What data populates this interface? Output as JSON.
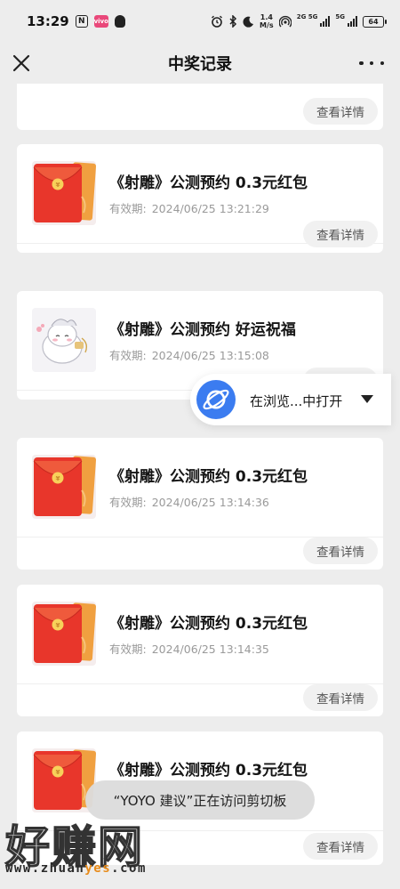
{
  "status_bar": {
    "time": "13:29",
    "nfc_label": "N",
    "app_badge": "vivo",
    "net_speed_value": "1.4",
    "net_speed_unit": "M/s",
    "sim1_tag": "2G 5G",
    "sim2_tag": "5G",
    "battery": "64"
  },
  "header": {
    "title": "中奖记录",
    "close_icon": "close-icon",
    "more_icon": "more-dots-icon"
  },
  "colors": {
    "background": "#ededed",
    "card": "#ffffff",
    "browser_accent": "#3b7cf0",
    "watermark_accent": "#e88b1a"
  },
  "partial_card": {
    "detail_label": "查看详情"
  },
  "records": [
    {
      "title": "《射雕》公测预约 0.3元红包",
      "validity_label": "有效期:",
      "validity_time": "2024/06/25 13:21:29",
      "thumb": "red-envelope",
      "detail_label": "查看详情"
    },
    {
      "title": "《射雕》公测预约 好运祝福",
      "validity_label": "有效期:",
      "validity_time": "2024/06/25 13:15:08",
      "thumb": "blessing-character",
      "detail_label": "查看详情"
    },
    {
      "title": "《射雕》公测预约 0.3元红包",
      "validity_label": "有效期:",
      "validity_time": "2024/06/25 13:14:36",
      "thumb": "red-envelope",
      "detail_label": "查看详情"
    },
    {
      "title": "《射雕》公测预约 0.3元红包",
      "validity_label": "有效期:",
      "validity_time": "2024/06/25 13:14:35",
      "thumb": "red-envelope",
      "detail_label": "查看详情"
    },
    {
      "title": "《射雕》公测预约 0.3元红包",
      "thumb": "red-envelope",
      "detail_label": "查看详情"
    }
  ],
  "browser_pill": {
    "label": "在浏览...中打开",
    "icon": "browser-planet-icon"
  },
  "toast": {
    "text": "“YOYO 建议”正在访问剪切板"
  },
  "watermark": {
    "main": "好赚网",
    "sub_prefix": "www.zhuan",
    "sub_highlight": "yes",
    "sub_suffix": ".com"
  }
}
